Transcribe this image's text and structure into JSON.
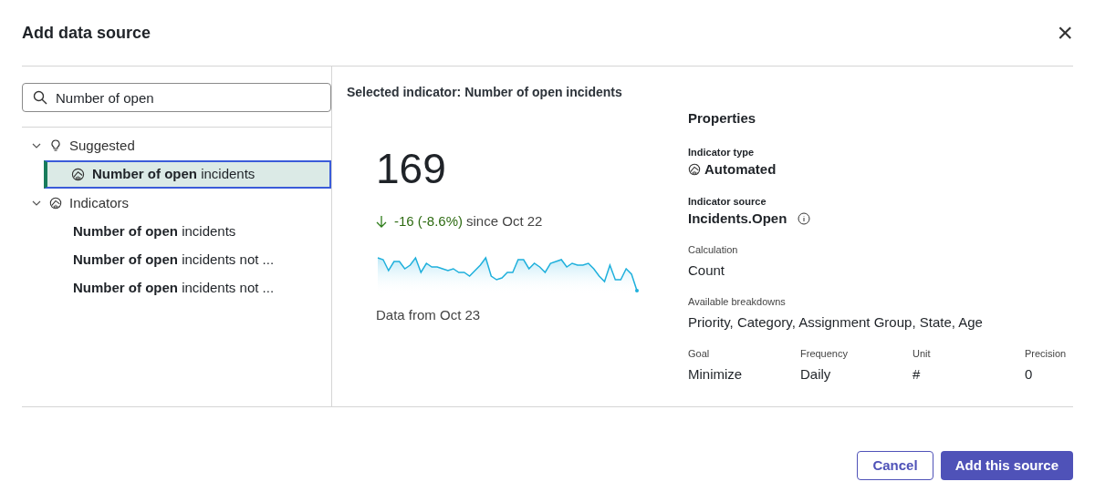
{
  "dialog": {
    "title": "Add data source",
    "close": "×"
  },
  "search": {
    "value": "Number of open"
  },
  "tree": [
    {
      "label": "Suggested",
      "kind": "bulb",
      "expanded": true,
      "children": [
        {
          "label": "**Number of open** incidents",
          "selected": true
        }
      ]
    },
    {
      "label": "Indicators",
      "kind": "gauge",
      "expanded": true,
      "children": [
        {
          "label": "**Number of open** incidents",
          "selected": false
        },
        {
          "label": "**Number of open** incidents not ...",
          "selected": false
        },
        {
          "label": "**Number of open** incidents not ...",
          "selected": false
        }
      ]
    }
  ],
  "detail": {
    "heading": "Selected indicator: Number of open incidents",
    "value": "169",
    "trend": {
      "change": "-16 (-8.6%)",
      "since": "since Oct 22"
    },
    "data_from": "Data from Oct 23"
  },
  "properties": {
    "title": "Properties",
    "type": {
      "label": "Indicator type",
      "value": "Automated"
    },
    "source": {
      "label": "Indicator source",
      "value": "Incidents.Open"
    },
    "calculation": {
      "label": "Calculation",
      "value": "Count"
    },
    "breakdowns": {
      "label": "Available breakdowns",
      "value": "Priority, Category, Assignment Group, State, Age"
    },
    "grid": [
      {
        "label": "Goal",
        "value": "Minimize"
      },
      {
        "label": "Frequency",
        "value": "Daily"
      },
      {
        "label": "Unit",
        "value": "#"
      },
      {
        "label": "Precision",
        "value": "0"
      }
    ]
  },
  "buttons": [
    {
      "label": "Cancel",
      "kind": "secondary"
    },
    {
      "label": "Add this source",
      "kind": "primary"
    }
  ]
}
